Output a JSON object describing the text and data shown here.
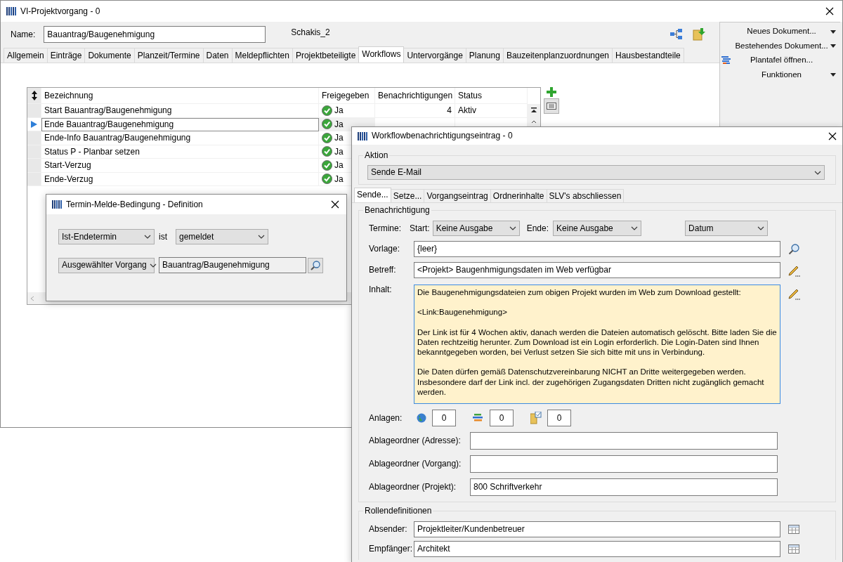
{
  "main_window": {
    "title": "VI-Projektvorgang - 0",
    "name_label": "Name:",
    "name_value": "Bauantrag/Baugenehmigung",
    "user": "Schakis_2",
    "tabs": [
      {
        "label": "Allgemein",
        "selected": false
      },
      {
        "label": "Einträge",
        "selected": false
      },
      {
        "label": "Dokumente",
        "selected": false
      },
      {
        "label": "Planzeit/Termine",
        "selected": false
      },
      {
        "label": "Daten",
        "selected": false
      },
      {
        "label": "Meldepflichten",
        "selected": false
      },
      {
        "label": "Projektbeteiligte",
        "selected": false
      },
      {
        "label": "Workflows",
        "selected": true
      },
      {
        "label": "Untervorgänge",
        "selected": false
      },
      {
        "label": "Planung",
        "selected": false
      },
      {
        "label": "Bauzeitenplanzuordnungen",
        "selected": false
      },
      {
        "label": "Hausbestandteile",
        "selected": false
      }
    ],
    "side_menu": [
      {
        "label": "Neues Dokument...",
        "kind": "dropdown"
      },
      {
        "label": "Bestehendes Dokument...",
        "kind": "dropdown"
      },
      {
        "label": "Plantafel öffnen...",
        "kind": "action"
      },
      {
        "label": "Funktionen",
        "kind": "dropdown"
      }
    ]
  },
  "workflow_table": {
    "columns": [
      "Bezeichnung",
      "Freigegeben",
      "Benachrichtigungen",
      "Status"
    ],
    "rows": [
      {
        "name": "Start Bauantrag/Baugenehmigung",
        "released": "Ja",
        "notifications": "4",
        "status": "Aktiv",
        "selected": false
      },
      {
        "name": "Ende Bauantrag/Baugenehmigung",
        "released": "Ja",
        "selected": true
      },
      {
        "name": "Ende-Info Bauantrag/Baugenehmigung",
        "released": "Ja",
        "selected": false
      },
      {
        "name": "Status P - Planbar setzen",
        "released": "Ja",
        "selected": false
      },
      {
        "name": "Start-Verzug",
        "released": "Ja",
        "selected": false
      },
      {
        "name": "Ende-Verzug",
        "released": "Ja",
        "selected": false
      }
    ]
  },
  "condition_dialog": {
    "title": "Termin-Melde-Bedingung - Definition",
    "date_select": "Ist-Endetermin",
    "connector": "ist",
    "state_select": "gemeldet",
    "scope_select": "Ausgewählter Vorgang",
    "process_value": "Bauantrag/Baugenehmigung"
  },
  "notification_dialog": {
    "title": "Workflowbenachrichtigungseintrag - 0",
    "action_group": "Aktion",
    "action": "Sende E-Mail",
    "tabs": [
      {
        "label": "Sende...",
        "selected": true
      },
      {
        "label": "Setze...",
        "selected": false
      },
      {
        "label": "Vorgangseintrag",
        "selected": false
      },
      {
        "label": "Ordnerinhalte",
        "selected": false
      },
      {
        "label": "SLV's abschliessen",
        "selected": false
      }
    ],
    "notification_group": "Benachrichtigung",
    "dates_label": "Termine:",
    "start_label": "Start:",
    "start_value": "Keine Ausgabe",
    "end_label": "Ende:",
    "end_value": "Keine Ausgabe",
    "format_value": "Datum",
    "template_label": "Vorlage:",
    "template_value": "{leer}",
    "subject_label": "Betreff:",
    "subject_value": "<Projekt> Baugenhmigungsdaten im Web verfügbar",
    "content_label": "Inhalt:",
    "content_paragraphs": [
      "Die Baugenehmigungsdateien zum obigen Projekt wurden im Web zum Download gestellt:",
      "<Link:Baugenehmigung>",
      "Der Link ist für 4 Wochen aktiv, danach werden die Dateien automatisch gelöscht. Bitte laden Sie die Daten rechtzeitig herunter. Zum Download ist ein Login erforderlich. Die Login-Daten sind Ihnen bekanntgegeben worden, bei Verlust setzen Sie sich bitte mit uns in Verbindung.",
      "Die Daten dürfen gemäß Datenschutzvereinbarung NICHT an Dritte weitergegeben werden. Insbesondere darf der Link incl. der zugehörigen Zugangsdaten Dritten nicht zugänglich gemacht werden."
    ],
    "attachments_label": "Anlagen:",
    "attachments": [
      {
        "kind": "globe",
        "count": "0"
      },
      {
        "kind": "stack",
        "count": "0"
      },
      {
        "kind": "folder",
        "count": "0"
      }
    ],
    "folders": [
      {
        "label": "Ablageordner (Adresse):"
      },
      {
        "label": "Ablageordner (Vorgang):"
      },
      {
        "label": "Ablageordner (Projekt):",
        "value": "800 Schriftverkehr"
      }
    ],
    "roles_group": "Rollendefinitionen",
    "roles": [
      {
        "label": "Absender:",
        "value": "Projektleiter/Kundenbetreuer"
      },
      {
        "label": "Empfänger:",
        "value": "Architekt"
      }
    ]
  }
}
